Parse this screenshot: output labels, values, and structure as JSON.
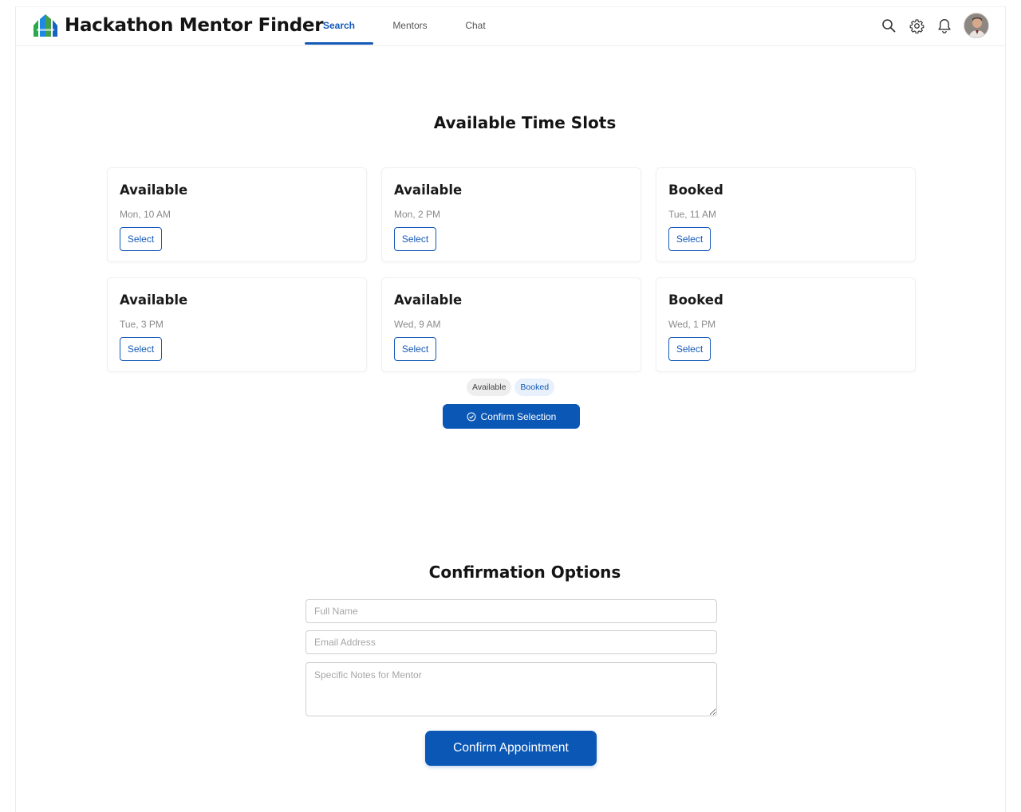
{
  "app": {
    "title": "Hackathon Mentor Finder"
  },
  "nav": {
    "tabs": [
      {
        "label": "Search",
        "active": true
      },
      {
        "label": "Mentors",
        "active": false
      },
      {
        "label": "Chat",
        "active": false
      }
    ]
  },
  "header_icons": [
    "search-icon",
    "gear-icon",
    "bell-icon",
    "avatar"
  ],
  "colors": {
    "primary": "#0a57b5",
    "accent": "#1459b8"
  },
  "slots_section": {
    "title": "Available Time Slots",
    "slots": [
      {
        "status": "Available",
        "time": "Mon, 10 AM",
        "button": "Select"
      },
      {
        "status": "Available",
        "time": "Mon, 2 PM",
        "button": "Select"
      },
      {
        "status": "Booked",
        "time": "Tue, 11 AM",
        "button": "Select"
      },
      {
        "status": "Available",
        "time": "Tue, 3 PM",
        "button": "Select"
      },
      {
        "status": "Available",
        "time": "Wed, 9 AM",
        "button": "Select"
      },
      {
        "status": "Booked",
        "time": "Wed, 1 PM",
        "button": "Select"
      }
    ],
    "legend": {
      "available": "Available",
      "booked": "Booked"
    },
    "confirm_label": "Confirm Selection"
  },
  "confirmation": {
    "title": "Confirmation Options",
    "full_name_placeholder": "Full Name",
    "email_placeholder": "Email Address",
    "notes_placeholder": "Specific Notes for Mentor",
    "submit_label": "Confirm Appointment"
  }
}
